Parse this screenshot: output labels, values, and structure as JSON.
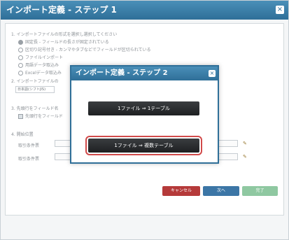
{
  "outer": {
    "title": "インポート定義 - ステップ 1",
    "close": "×",
    "section1": "1. インポートファイルの形式を選択し選択してください",
    "opt1": "固定長 - フィールドの長さが固定されている",
    "opt2": "区切り記号付き - カンマやタブなどでフィールドが区切られている",
    "opt3": "ファイルインポート",
    "opt4": "用語データ取込み",
    "opt5": "Excelデータ取込み",
    "section2": "2. インポートファイルの",
    "select_value": "日本語(シフトJIS)",
    "section3": "3. 先頭行をフィールド名",
    "chk_label": "先頭行をフィールド",
    "section4": "4. 開始位置",
    "row_label1": "取引条件票",
    "row_label2": "取引条件票",
    "cancel": "キャンセル",
    "next": "次へ",
    "finish": "完了"
  },
  "modal": {
    "title": "インポート定義 - ステップ 2",
    "close": "×",
    "btn1": "1ファイル ⇒ 1テーブル",
    "btn2": "1ファイル ⇒ 複数テーブル"
  }
}
